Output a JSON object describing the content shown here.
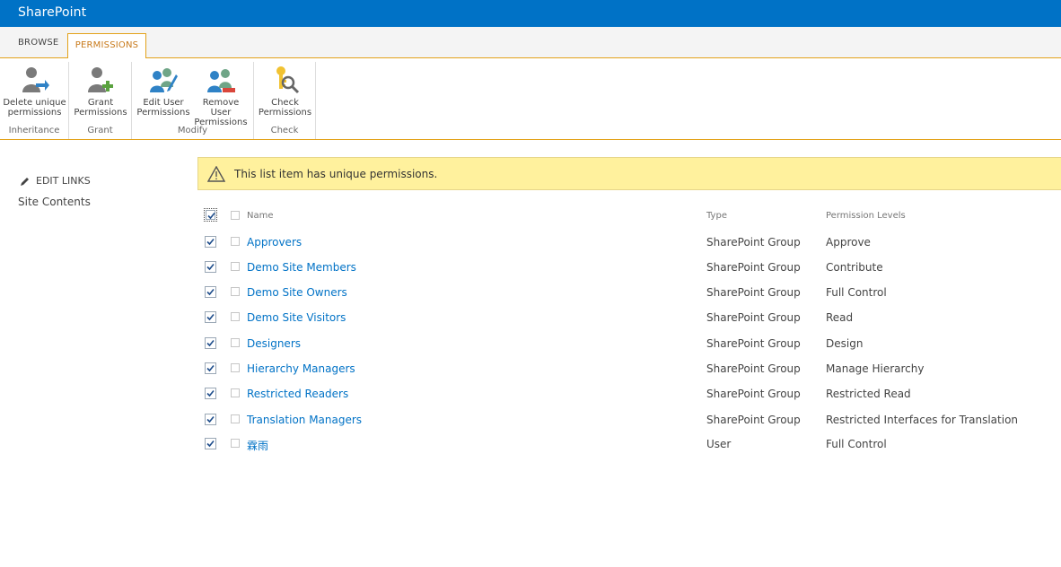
{
  "suite": {
    "brand": "SharePoint"
  },
  "tabs": [
    {
      "label": "BROWSE"
    },
    {
      "label": "PERMISSIONS"
    }
  ],
  "ribbon": {
    "groups": [
      {
        "label": "Inheritance",
        "buttons": [
          {
            "line1": "Delete unique",
            "line2": "permissions",
            "icon": "delete-unique-permissions-icon"
          }
        ]
      },
      {
        "label": "Grant",
        "buttons": [
          {
            "line1": "Grant",
            "line2": "Permissions",
            "icon": "grant-permissions-icon"
          }
        ]
      },
      {
        "label": "Modify",
        "buttons": [
          {
            "line1": "Edit User",
            "line2": "Permissions",
            "icon": "edit-user-permissions-icon"
          },
          {
            "line1": "Remove User",
            "line2": "Permissions",
            "icon": "remove-user-permissions-icon"
          }
        ]
      },
      {
        "label": "Check",
        "buttons": [
          {
            "line1": "Check",
            "line2": "Permissions",
            "icon": "check-permissions-icon"
          }
        ]
      }
    ]
  },
  "nav": {
    "edit_links": "EDIT LINKS",
    "site_contents": "Site Contents"
  },
  "alert": {
    "text": "This list item has unique permissions.",
    "color": "#fff19d"
  },
  "table": {
    "headers": {
      "name": "Name",
      "type": "Type",
      "permission": "Permission Levels"
    },
    "rows": [
      {
        "name": "Approvers",
        "type": "SharePoint Group",
        "permission": "Approve",
        "checked": true
      },
      {
        "name": "Demo Site Members",
        "type": "SharePoint Group",
        "permission": "Contribute",
        "checked": true
      },
      {
        "name": "Demo Site Owners",
        "type": "SharePoint Group",
        "permission": "Full Control",
        "checked": true
      },
      {
        "name": "Demo Site Visitors",
        "type": "SharePoint Group",
        "permission": "Read",
        "checked": true
      },
      {
        "name": "Designers",
        "type": "SharePoint Group",
        "permission": "Design",
        "checked": true
      },
      {
        "name": "Hierarchy Managers",
        "type": "SharePoint Group",
        "permission": "Manage Hierarchy",
        "checked": true
      },
      {
        "name": "Restricted Readers",
        "type": "SharePoint Group",
        "permission": "Restricted Read",
        "checked": true
      },
      {
        "name": "Translation Managers",
        "type": "SharePoint Group",
        "permission": "Restricted Interfaces for Translation",
        "checked": true
      },
      {
        "name": "霖雨",
        "type": "User",
        "permission": "Full Control",
        "checked": true
      }
    ]
  },
  "colors": {
    "suite_bar": "#0072c6",
    "accent": "#e3a21a",
    "link": "#0072c6"
  }
}
